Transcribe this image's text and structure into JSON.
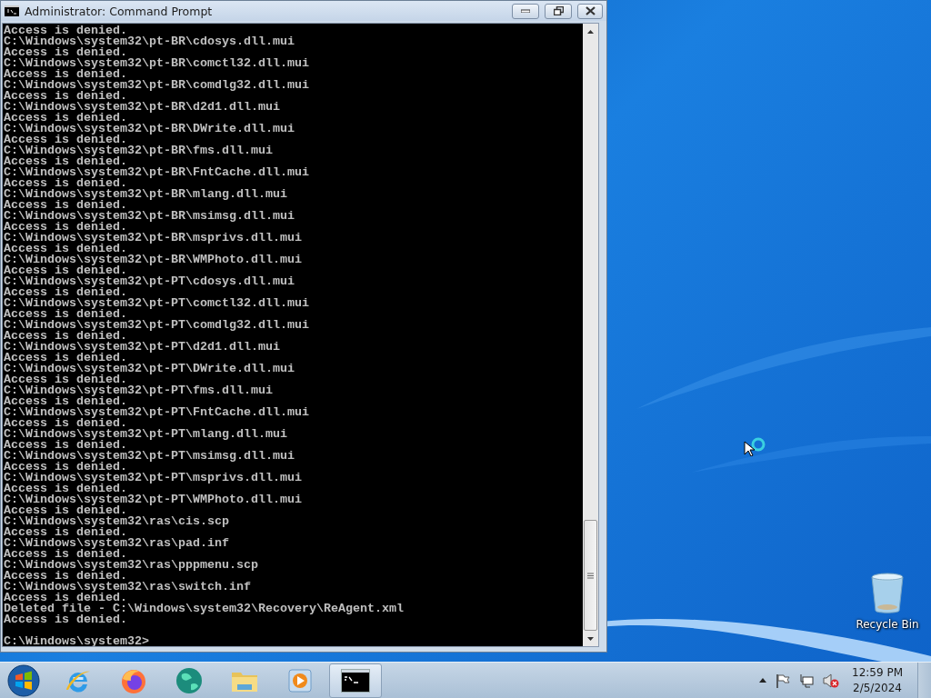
{
  "window": {
    "title": "Administrator: Command Prompt"
  },
  "console": {
    "lines": [
      "Access is denied.",
      "C:\\Windows\\system32\\pt-BR\\cdosys.dll.mui",
      "Access is denied.",
      "C:\\Windows\\system32\\pt-BR\\comctl32.dll.mui",
      "Access is denied.",
      "C:\\Windows\\system32\\pt-BR\\comdlg32.dll.mui",
      "Access is denied.",
      "C:\\Windows\\system32\\pt-BR\\d2d1.dll.mui",
      "Access is denied.",
      "C:\\Windows\\system32\\pt-BR\\DWrite.dll.mui",
      "Access is denied.",
      "C:\\Windows\\system32\\pt-BR\\fms.dll.mui",
      "Access is denied.",
      "C:\\Windows\\system32\\pt-BR\\FntCache.dll.mui",
      "Access is denied.",
      "C:\\Windows\\system32\\pt-BR\\mlang.dll.mui",
      "Access is denied.",
      "C:\\Windows\\system32\\pt-BR\\msimsg.dll.mui",
      "Access is denied.",
      "C:\\Windows\\system32\\pt-BR\\msprivs.dll.mui",
      "Access is denied.",
      "C:\\Windows\\system32\\pt-BR\\WMPhoto.dll.mui",
      "Access is denied.",
      "C:\\Windows\\system32\\pt-PT\\cdosys.dll.mui",
      "Access is denied.",
      "C:\\Windows\\system32\\pt-PT\\comctl32.dll.mui",
      "Access is denied.",
      "C:\\Windows\\system32\\pt-PT\\comdlg32.dll.mui",
      "Access is denied.",
      "C:\\Windows\\system32\\pt-PT\\d2d1.dll.mui",
      "Access is denied.",
      "C:\\Windows\\system32\\pt-PT\\DWrite.dll.mui",
      "Access is denied.",
      "C:\\Windows\\system32\\pt-PT\\fms.dll.mui",
      "Access is denied.",
      "C:\\Windows\\system32\\pt-PT\\FntCache.dll.mui",
      "Access is denied.",
      "C:\\Windows\\system32\\pt-PT\\mlang.dll.mui",
      "Access is denied.",
      "C:\\Windows\\system32\\pt-PT\\msimsg.dll.mui",
      "Access is denied.",
      "C:\\Windows\\system32\\pt-PT\\msprivs.dll.mui",
      "Access is denied.",
      "C:\\Windows\\system32\\pt-PT\\WMPhoto.dll.mui",
      "Access is denied.",
      "C:\\Windows\\system32\\ras\\cis.scp",
      "Access is denied.",
      "C:\\Windows\\system32\\ras\\pad.inf",
      "Access is denied.",
      "C:\\Windows\\system32\\ras\\pppmenu.scp",
      "Access is denied.",
      "C:\\Windows\\system32\\ras\\switch.inf",
      "Access is denied.",
      "Deleted file - C:\\Windows\\system32\\Recovery\\ReAgent.xml",
      "Access is denied."
    ],
    "prompt": "C:\\Windows\\system32>"
  },
  "desktop": {
    "icons": [
      {
        "label": "Recycle Bin"
      }
    ]
  },
  "taskbar": {
    "apps": [
      {
        "kind": "ie",
        "selected": false
      },
      {
        "kind": "firefox",
        "selected": false
      },
      {
        "kind": "globe",
        "selected": false
      },
      {
        "kind": "folder",
        "selected": false
      },
      {
        "kind": "media",
        "selected": false
      },
      {
        "kind": "cmd",
        "selected": true
      }
    ],
    "clock": {
      "time": "12:59 PM",
      "date": "2/5/2024"
    }
  }
}
